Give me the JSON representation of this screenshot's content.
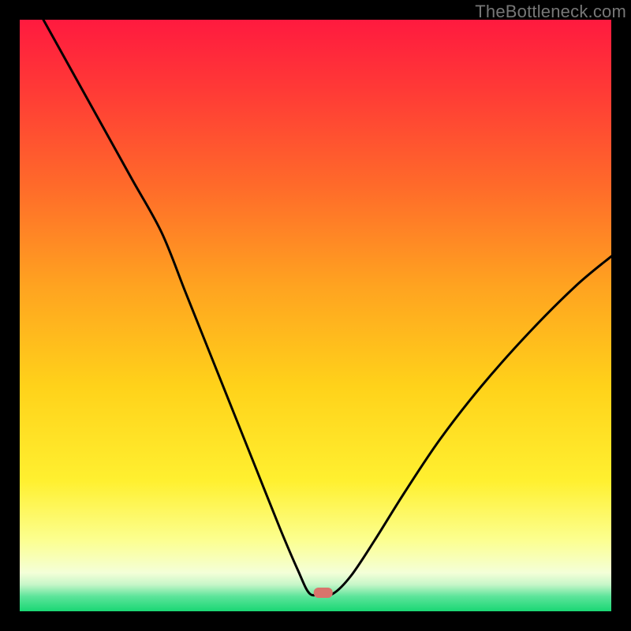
{
  "watermark": "TheBottleneck.com",
  "marker": {
    "color": "#d9746c",
    "x_frac": 0.513,
    "y_frac": 0.968
  },
  "gradient_stops": [
    {
      "offset": 0.0,
      "color": "#ff1a3f"
    },
    {
      "offset": 0.12,
      "color": "#ff3a36"
    },
    {
      "offset": 0.28,
      "color": "#ff6a2a"
    },
    {
      "offset": 0.45,
      "color": "#ffa320"
    },
    {
      "offset": 0.62,
      "color": "#ffd21a"
    },
    {
      "offset": 0.78,
      "color": "#fff030"
    },
    {
      "offset": 0.88,
      "color": "#fcff90"
    },
    {
      "offset": 0.935,
      "color": "#f4ffd8"
    },
    {
      "offset": 0.955,
      "color": "#c6f6c8"
    },
    {
      "offset": 0.975,
      "color": "#5ce49a"
    },
    {
      "offset": 1.0,
      "color": "#1ad774"
    }
  ],
  "chart_data": {
    "type": "line",
    "title": "",
    "xlabel": "",
    "ylabel": "",
    "xlim": [
      0,
      1
    ],
    "ylim": [
      0,
      1
    ],
    "series": [
      {
        "name": "bottleneck-curve",
        "x": [
          0.04,
          0.09,
          0.14,
          0.19,
          0.24,
          0.28,
          0.32,
          0.36,
          0.4,
          0.44,
          0.47,
          0.49,
          0.51,
          0.53,
          0.56,
          0.6,
          0.65,
          0.71,
          0.78,
          0.86,
          0.94,
          1.0
        ],
        "y": [
          1.0,
          0.91,
          0.82,
          0.73,
          0.64,
          0.54,
          0.44,
          0.34,
          0.24,
          0.14,
          0.07,
          0.03,
          0.03,
          0.03,
          0.06,
          0.12,
          0.2,
          0.29,
          0.38,
          0.47,
          0.55,
          0.6
        ]
      }
    ],
    "valley_flat": {
      "x_start": 0.49,
      "x_end": 0.53,
      "y": 0.03
    },
    "notes": "x and y are normalized 0..1 fractions of the plot area; y=0 at bottom. Values estimated from pixels."
  }
}
